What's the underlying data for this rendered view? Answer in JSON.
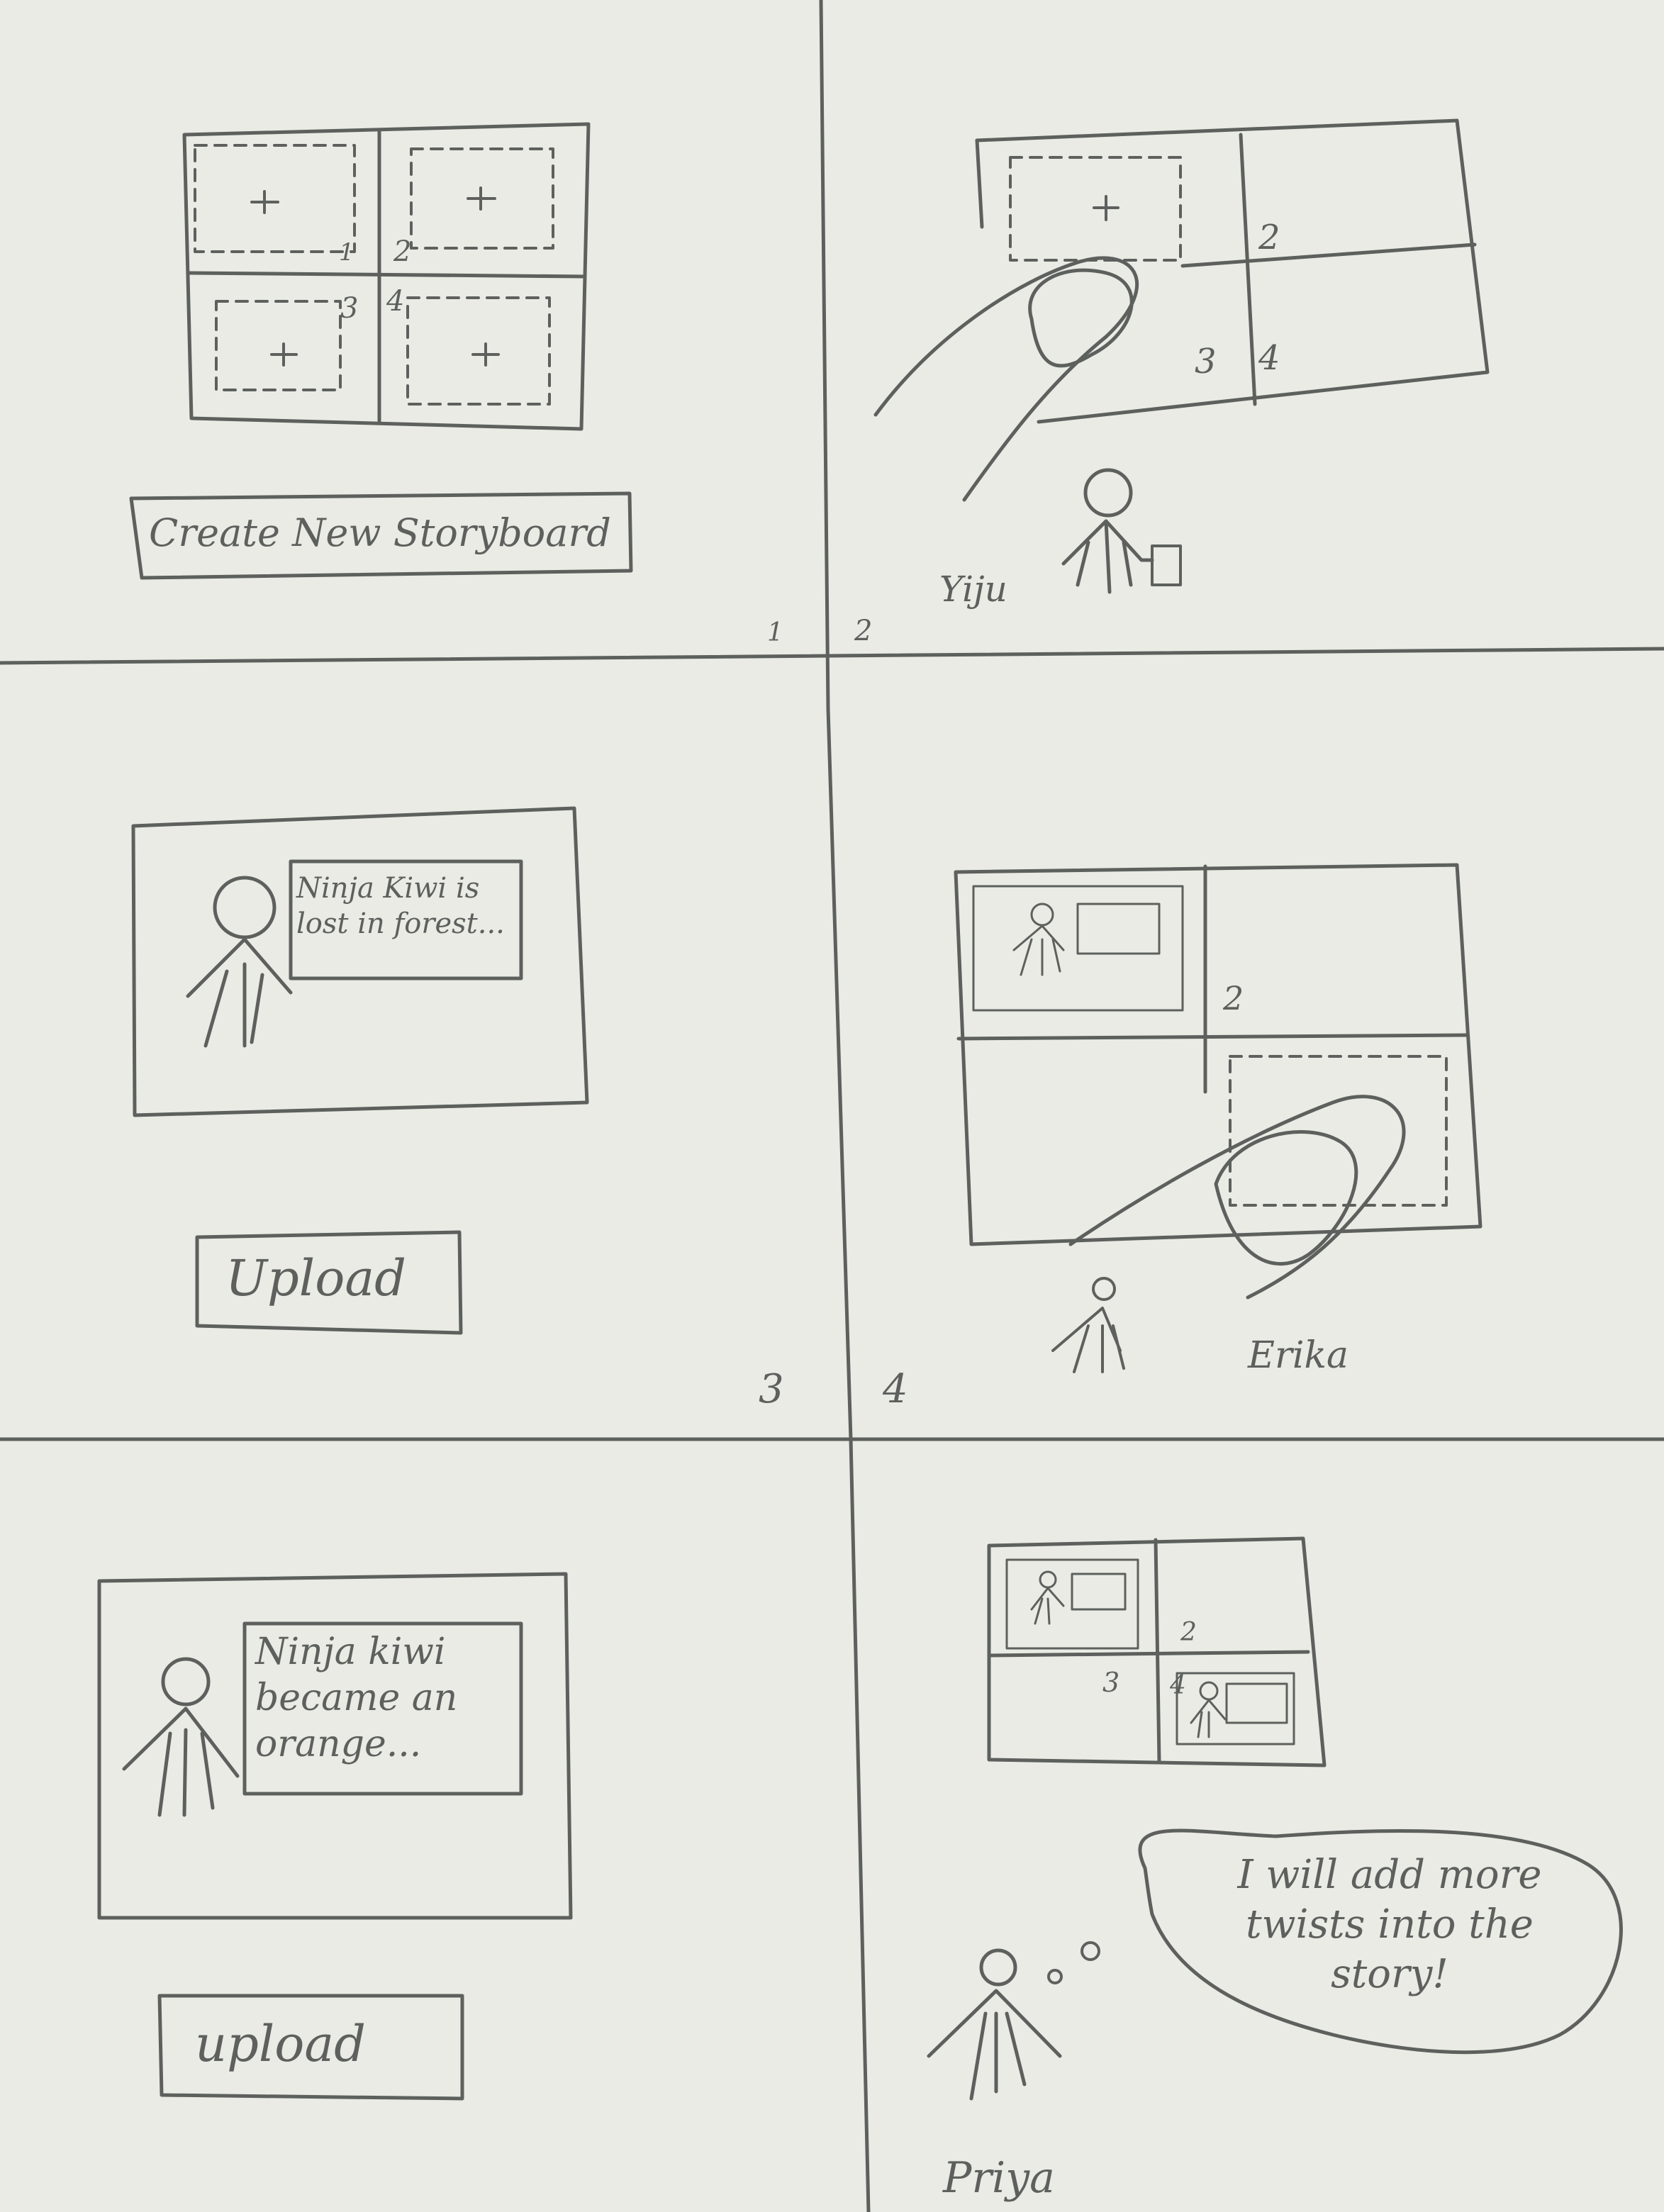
{
  "panel1": {
    "grid_numbers": [
      "1",
      "2",
      "3",
      "4"
    ],
    "plus": "+",
    "create_button_label": "Create New Storyboard"
  },
  "panel2": {
    "cell_numbers": [
      "2",
      "3",
      "4"
    ],
    "plus": "+",
    "person_name": "Yiju"
  },
  "panel3": {
    "caption": "Ninja Kiwi is lost in forest...",
    "upload_button_label": "Upload"
  },
  "panel4": {
    "cell_numbers": [
      "2"
    ],
    "person_name": "Erika"
  },
  "panel5": {
    "caption": "Ninja kiwi became an orange...",
    "upload_button_label": "upload"
  },
  "panel6": {
    "cell_numbers": [
      "2",
      "3",
      "4"
    ],
    "thought": "I will add more twists into the story!",
    "person_name": "Priya"
  },
  "panel_numbers": [
    "1",
    "2",
    "3",
    "4"
  ]
}
